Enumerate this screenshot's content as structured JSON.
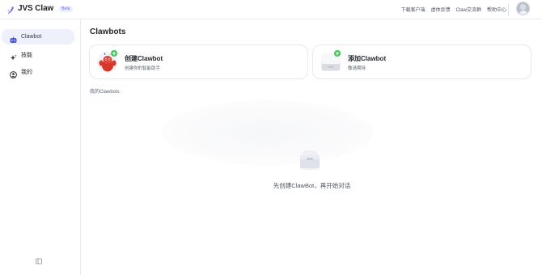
{
  "brand": {
    "name": "JVS Claw",
    "badge": "Beta"
  },
  "topnav": {
    "items": [
      "下载客户端",
      "虚体反馈",
      "Claw交流群",
      "帮助中心"
    ]
  },
  "sidebar": {
    "items": [
      {
        "label": "Clawbot",
        "icon": "bot-icon",
        "active": true
      },
      {
        "label": "技能",
        "icon": "sparkle-icon",
        "active": false
      },
      {
        "label": "我的",
        "icon": "user-icon",
        "active": false
      }
    ]
  },
  "main": {
    "title": "Clawbots",
    "cards": [
      {
        "title": "创建Clawbot",
        "subtitle": "创建你的智能助手"
      },
      {
        "title": "添加Clawbot",
        "subtitle": "敬请期待"
      }
    ],
    "section_label": "我的Clawbots",
    "empty_text": "先创建ClawBot，再开始对话"
  },
  "colors": {
    "accent": "#4f5bd5",
    "active_bg": "#eef0fb",
    "plus_green": "#3cc353"
  }
}
